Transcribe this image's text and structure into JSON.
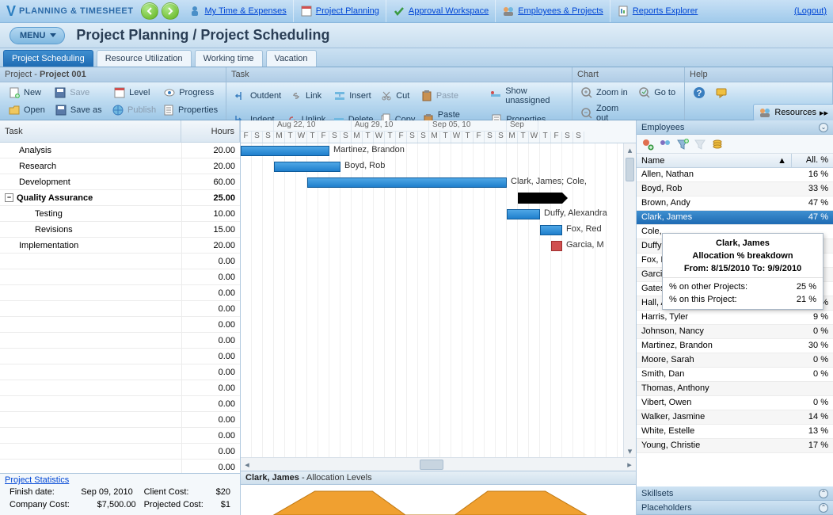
{
  "top": {
    "logo_text": "PLANNING & TIMESHEET",
    "links": [
      "My Time & Expenses",
      "Project Planning",
      "Approval Workspace",
      "Employees & Projects",
      "Reports Explorer"
    ],
    "logout": "(Logout)"
  },
  "menu_label": "MENU",
  "page_title": "Project Planning / Project Scheduling",
  "tabs": [
    "Project Scheduling",
    "Resource Utilization",
    "Working time",
    "Vacation"
  ],
  "active_tab": 0,
  "tb_headers": {
    "project_prefix": "Project -",
    "project_name": "Project 001",
    "task": "Task",
    "chart": "Chart",
    "help": "Help"
  },
  "toolbar": {
    "project": [
      [
        "New",
        "Save",
        "Level",
        "Progress"
      ],
      [
        "Open",
        "Save as",
        "Publish",
        "Properties"
      ]
    ],
    "task": [
      [
        "Outdent",
        "Link",
        "Insert",
        "Cut",
        "Paste",
        "Show unassigned"
      ],
      [
        "Indent",
        "Unlink",
        "Delete",
        "Copy",
        "Paste external",
        "Properties"
      ]
    ],
    "chart": [
      [
        "Zoom in",
        "Go to"
      ],
      [
        "Zoom out"
      ]
    ]
  },
  "resources_label": "Resources",
  "grid": {
    "col_task": "Task",
    "col_hours": "Hours",
    "rows": [
      {
        "name": "Analysis",
        "hours": "20.00",
        "indent": 1
      },
      {
        "name": "Research",
        "hours": "20.00",
        "indent": 1
      },
      {
        "name": "Development",
        "hours": "60.00",
        "indent": 1
      },
      {
        "name": "Quality Assurance",
        "hours": "25.00",
        "indent": 0,
        "bold": true,
        "expander": "−"
      },
      {
        "name": "Testing",
        "hours": "10.00",
        "indent": 2
      },
      {
        "name": "Revisions",
        "hours": "15.00",
        "indent": 2
      },
      {
        "name": "Implementation",
        "hours": "20.00",
        "indent": 1
      }
    ],
    "empty_hours": "0.00"
  },
  "stats": {
    "title": "Project Statistics",
    "finish_label": "Finish date:",
    "finish_value": "Sep 09, 2010",
    "client_label": "Client Cost:",
    "client_value": "$20",
    "company_label": "Company Cost:",
    "company_value": "$7,500.00",
    "projected_label": "Projected Cost:",
    "projected_value": "$1"
  },
  "timeline": {
    "weeks": [
      "Aug 22, 10",
      "Aug 29, 10",
      "Sep 05, 10",
      "Sep"
    ],
    "days": [
      "F",
      "S",
      "S",
      "M",
      "T",
      "W",
      "T",
      "F",
      "S",
      "S",
      "M",
      "T",
      "W",
      "T",
      "F",
      "S",
      "S",
      "M",
      "T",
      "W",
      "T",
      "F",
      "S",
      "S",
      "M",
      "T",
      "W",
      "T",
      "F",
      "S",
      "S"
    ],
    "assignees": [
      "Martinez, Brandon",
      "Boyd, Rob",
      "Clark, James; Cole,",
      "Duffy, Alexandra",
      "Fox, Red",
      "Garcia, M"
    ]
  },
  "alloc": {
    "name": "Clark, James",
    "suffix": " - Allocation Levels"
  },
  "right": {
    "employees_label": "Employees",
    "skillsets_label": "Skillsets",
    "placeholders_label": "Placeholders",
    "col_name": "Name",
    "col_all": "All. %",
    "list": [
      {
        "name": "Allen, Nathan",
        "pct": "16 %"
      },
      {
        "name": "Boyd, Rob",
        "pct": "33 %"
      },
      {
        "name": "Brown, Andy",
        "pct": "47 %"
      },
      {
        "name": "Clark, James",
        "pct": "47 %",
        "selected": true
      },
      {
        "name": "Cole,",
        "pct": ""
      },
      {
        "name": "Duffy",
        "pct": ""
      },
      {
        "name": "Fox, F",
        "pct": ""
      },
      {
        "name": "Garcia",
        "pct": ""
      },
      {
        "name": "Gates",
        "pct": ""
      },
      {
        "name": "Hall, Alexandra",
        "pct": "54 %"
      },
      {
        "name": "Harris, Tyler",
        "pct": "9 %"
      },
      {
        "name": "Johnson, Nancy",
        "pct": "0 %"
      },
      {
        "name": "Martinez, Brandon",
        "pct": "30 %"
      },
      {
        "name": "Moore, Sarah",
        "pct": "0 %"
      },
      {
        "name": "Smith, Dan",
        "pct": "0 %"
      },
      {
        "name": "Thomas, Anthony",
        "pct": ""
      },
      {
        "name": "Vibert, Owen",
        "pct": "0 %"
      },
      {
        "name": "Walker, Jasmine",
        "pct": "14 %"
      },
      {
        "name": "White, Estelle",
        "pct": "13 %"
      },
      {
        "name": "Young, Christie",
        "pct": "17 %"
      }
    ],
    "tooltip": {
      "name": "Clark, James",
      "title": "Allocation % breakdown",
      "range_label": "From: 8/15/2010 To: 9/9/2010",
      "other_label": "% on other Projects:",
      "other_value": "25 %",
      "this_label": "% on this Project:",
      "this_value": "21 %"
    }
  }
}
